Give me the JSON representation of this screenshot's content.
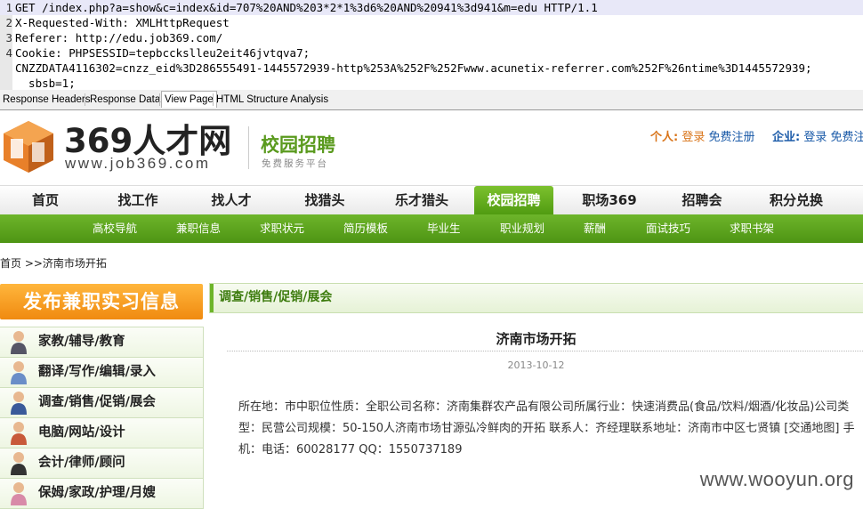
{
  "request": {
    "lines": [
      {
        "num": "1",
        "text": "GET /index.php?a=show&c=index&id=707%20AND%203*2*1%3d6%20AND%20941%3d941&m=edu HTTP/1.1"
      },
      {
        "num": "2",
        "text": "X-Requested-With: XMLHttpRequest"
      },
      {
        "num": "3",
        "text": "Referer: http://edu.job369.com/"
      },
      {
        "num": "4",
        "text": "Cookie: PHPSESSID=tepbcckslleu2eit46jvtqva7;"
      },
      {
        "num": "",
        "text": "CNZZDATA4116302=cnzz_eid%3D286555491-1445572939-http%253A%252F%252Fwww.acunetix-referrer.com%252F%26ntime%3D1445572939;"
      },
      {
        "num": "",
        "text": "  sbsb=1;"
      }
    ]
  },
  "tabs": [
    {
      "label": "Response Headers"
    },
    {
      "label": "Response Data"
    },
    {
      "label": "View Page"
    },
    {
      "label": "HTML Structure Analysis"
    }
  ],
  "site": {
    "logo_text": "369人才网",
    "logo_url": "www.job369.com",
    "campus_title": "校园招聘",
    "campus_sub": "免费服务平台",
    "personal_label": "个人:",
    "personal_login": "登录",
    "personal_register": "免费注册",
    "company_label": "企业:",
    "company_login": "登录",
    "company_register": "免费注"
  },
  "nav": [
    {
      "label": "首页"
    },
    {
      "label": "找工作"
    },
    {
      "label": "找人才"
    },
    {
      "label": "找猎头"
    },
    {
      "label": "乐才猎头"
    },
    {
      "label": "校园招聘"
    },
    {
      "label": "职场369"
    },
    {
      "label": "招聘会"
    },
    {
      "label": "积分兑换"
    }
  ],
  "subnav": [
    {
      "label": "高校导航"
    },
    {
      "label": "兼职信息"
    },
    {
      "label": "求职状元"
    },
    {
      "label": "简历模板"
    },
    {
      "label": "毕业生"
    },
    {
      "label": "职业规划"
    },
    {
      "label": "薪酬"
    },
    {
      "label": "面试技巧"
    },
    {
      "label": "求职书架"
    }
  ],
  "breadcrumb": "首页 >>济南市场开拓",
  "sidebar": {
    "publish": "发布兼职实习信息",
    "categories": [
      {
        "label": "家教/辅导/教育"
      },
      {
        "label": "翻译/写作/编辑/录入"
      },
      {
        "label": "调查/销售/促销/展会"
      },
      {
        "label": "电脑/网站/设计"
      },
      {
        "label": "会计/律师/顾问"
      },
      {
        "label": "保姆/家政/护理/月嫂"
      }
    ]
  },
  "main": {
    "section_title": "调查/销售/促销/展会",
    "article_title": "济南市场开拓",
    "date": "2013-10-12",
    "body": "所在地：市中职位性质：全职公司名称：济南集群农产品有限公司所属行业：快速消费品(食品/饮料/烟酒/化妆品)公司类型：民营公司规模：50-150人济南市场甘源弘冷鲜肉的开拓 联系人：齐经理联系地址：济南市中区七贤镇 [交通地图] 手机：电话：60028177 QQ：1550737189"
  },
  "watermark": "www.wooyun.org",
  "colors": {
    "green": "#5a9a1e",
    "orange": "#d9751b",
    "link_blue": "#1a5aa8"
  }
}
